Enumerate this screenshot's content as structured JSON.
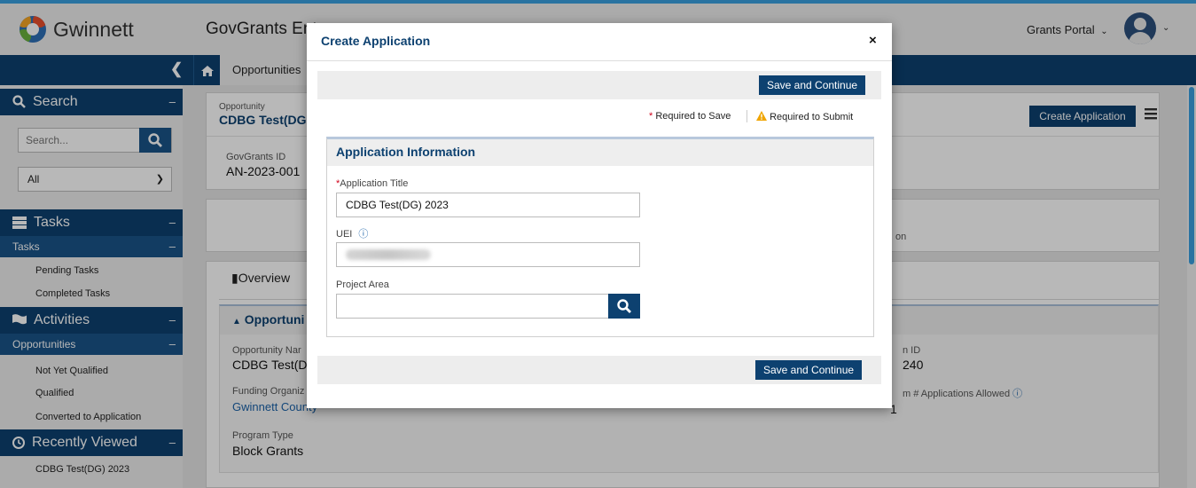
{
  "header": {
    "logo_text": "Gwinnett",
    "app_title": "GovGrants Ent",
    "portal_label": "Grants Portal"
  },
  "nav": {
    "breadcrumb": "Opportunities"
  },
  "sidebar": {
    "search": {
      "title": "Search",
      "placeholder": "Search...",
      "filter": "All"
    },
    "tasks": {
      "title": "Tasks",
      "sub": "Tasks",
      "items": [
        "Pending Tasks",
        "Completed Tasks"
      ]
    },
    "activities": {
      "title": "Activities",
      "sub": "Opportunities",
      "items": [
        "Not Yet Qualified",
        "Qualified",
        "Converted to Application"
      ]
    },
    "recent": {
      "title": "Recently Viewed",
      "items": [
        "CDBG Test(DG) 2023"
      ]
    }
  },
  "main": {
    "opportunity_label": "Opportunity",
    "opportunity_value": "CDBG Test(DG",
    "govgrants_id_label": "GovGrants ID",
    "govgrants_id_value": "AN-2023-001",
    "create_app_button": "Create Application",
    "side_text": "on",
    "overview_tab": "Overview",
    "section_title": "Opportuni",
    "opp_name_label": "Opportunity Nar",
    "opp_name_value": "CDBG Test(D",
    "funding_org_label": "Funding Organiz",
    "funding_org_value": "Gwinnett County",
    "program_type_label": "Program Type",
    "program_type_value": "Block Grants",
    "right_id_label": "n ID",
    "right_id_value": "240",
    "max_apps_label": "m # Applications Allowed",
    "max_apps_value": "1"
  },
  "modal": {
    "title": "Create Application",
    "close": "×",
    "save_top": "Save and Continue",
    "save_bottom": "Save and Continue",
    "req_save": "Required to Save",
    "req_submit": "Required to Submit",
    "section": "Application Information",
    "fields": {
      "app_title_label": "Application Title",
      "app_title_value": "CDBG Test(DG) 2023",
      "uei_label": "UEI",
      "project_area_label": "Project Area",
      "project_area_value": ""
    }
  },
  "colors": {
    "navy": "#0d4170",
    "accent": "#3aa0e0",
    "required": "#d0021b",
    "warning": "#f0a500"
  }
}
